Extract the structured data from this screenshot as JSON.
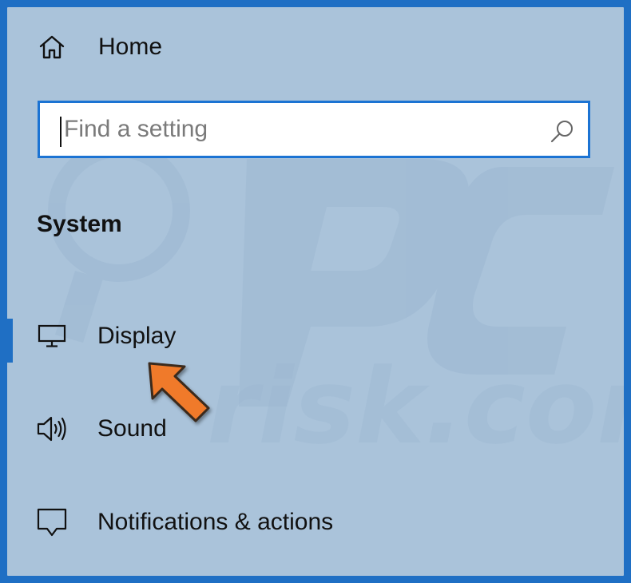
{
  "nav": {
    "home_label": "Home",
    "search_placeholder": "Find a setting",
    "section_title": "System",
    "items": [
      {
        "label": "Display",
        "icon": "monitor-icon",
        "selected": true
      },
      {
        "label": "Sound",
        "icon": "speaker-icon",
        "selected": false
      },
      {
        "label": "Notifications & actions",
        "icon": "notification-icon",
        "selected": false
      }
    ]
  },
  "colors": {
    "background": "#aac3da",
    "border": "#1f6fc4",
    "search_border": "#1b73d3",
    "arrow": "#f07a2a"
  }
}
